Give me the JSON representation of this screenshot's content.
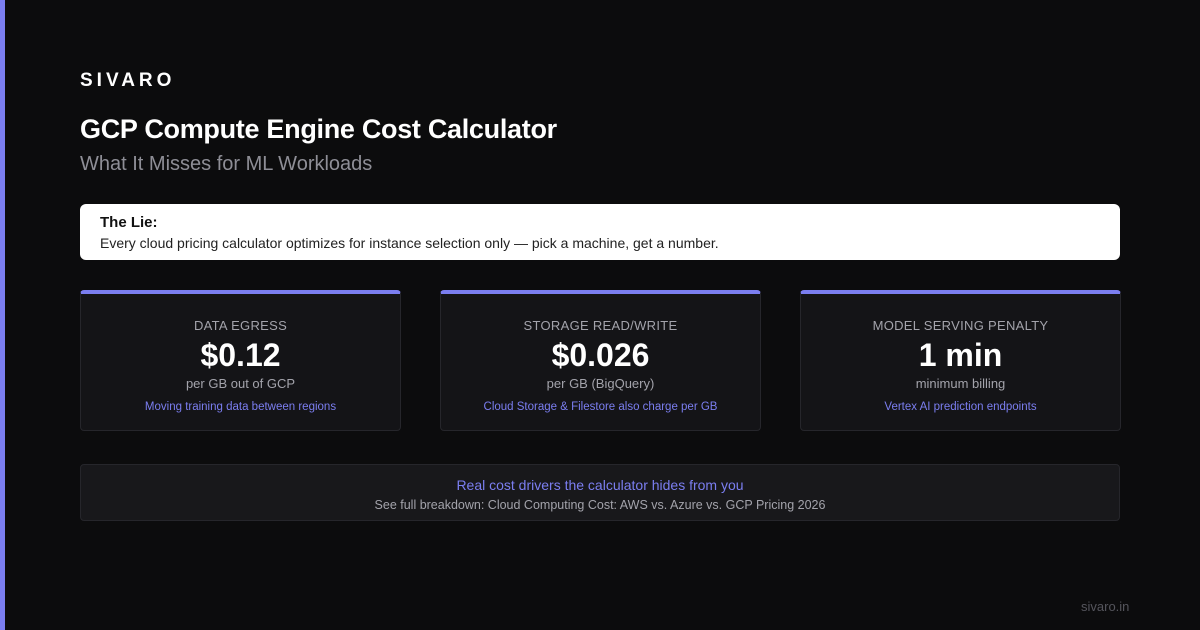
{
  "brand": "SIVARO",
  "title": "GCP Compute Engine Cost Calculator",
  "subtitle": "What It Misses for ML Workloads",
  "lie": {
    "label": "The Lie:",
    "text": "Every cloud pricing calculator optimizes for instance selection only — pick a machine, get a number."
  },
  "cards": [
    {
      "label": "DATA EGRESS",
      "value": "$0.12",
      "unit": "per GB out of GCP",
      "note": "Moving training data between regions"
    },
    {
      "label": "STORAGE READ/WRITE",
      "value": "$0.026",
      "unit": "per GB (BigQuery)",
      "note": "Cloud Storage & Filestore also charge per GB"
    },
    {
      "label": "MODEL SERVING PENALTY",
      "value": "1 min",
      "unit": "minimum billing",
      "note": "Vertex AI prediction endpoints"
    }
  ],
  "footer": {
    "headline": "Real cost drivers the calculator hides from you",
    "link": "See full breakdown: Cloud Computing Cost: AWS vs. Azure vs. GCP Pricing 2026"
  },
  "domain": "sivaro.in",
  "colors": {
    "accent": "#7b7ef0",
    "background": "#0c0c0d",
    "card": "#141417"
  }
}
